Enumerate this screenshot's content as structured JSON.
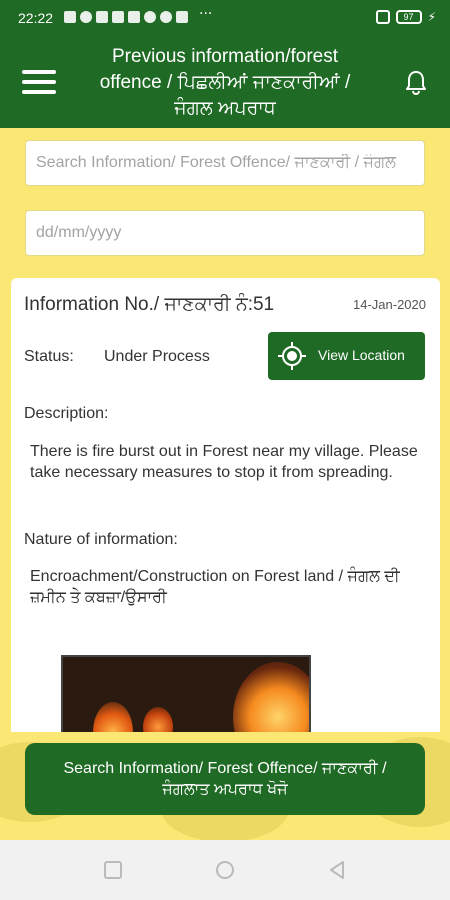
{
  "status_bar": {
    "time": "22:22",
    "battery": "97",
    "overflow": "···"
  },
  "header": {
    "title": "Previous information/forest offence / ਪਿਛਲੀਆਂ ਜਾਣਕਾਰੀਆਂ / ਜੰਗਲ ਅਪਰਾਧ"
  },
  "search": {
    "placeholder": "Search Information/ Forest Offence/ ਜਾਣਕਾਰੀ / ਜੰਗਲ"
  },
  "date_filter": {
    "placeholder": "dd/mm/yyyy"
  },
  "card": {
    "info_no": "Information No./ ਜਾਣਕਾਰੀ ਨੰ:51",
    "date": "14-Jan-2020",
    "status_label": "Status:",
    "status_value": "Under Process",
    "view_location_label": "View Location",
    "description_label": "Description:",
    "description_text": "There is fire burst out in Forest near my village. Please take necessary measures to stop it from spreading.",
    "nature_label": "Nature of information:",
    "nature_text": "Encroachment/Construction on Forest land / ਜੰਗਲ ਦੀ ਜ਼ਮੀਨ ਤੇ ਕਬਜ਼ਾ/ਉਸਾਰੀ"
  },
  "search_button": {
    "label": "Search Information/ Forest Offence/ ਜਾਣਕਾਰੀ / ਜੰਗਲਾਤ ਅਪਰਾਧ ਖੋਜੋ"
  },
  "colors": {
    "primary": "#1f6a25",
    "background": "#fbe774"
  },
  "icons": [
    "menu-icon",
    "bell-icon",
    "location-target-icon",
    "square-nav-icon",
    "circle-nav-icon",
    "back-nav-icon"
  ]
}
